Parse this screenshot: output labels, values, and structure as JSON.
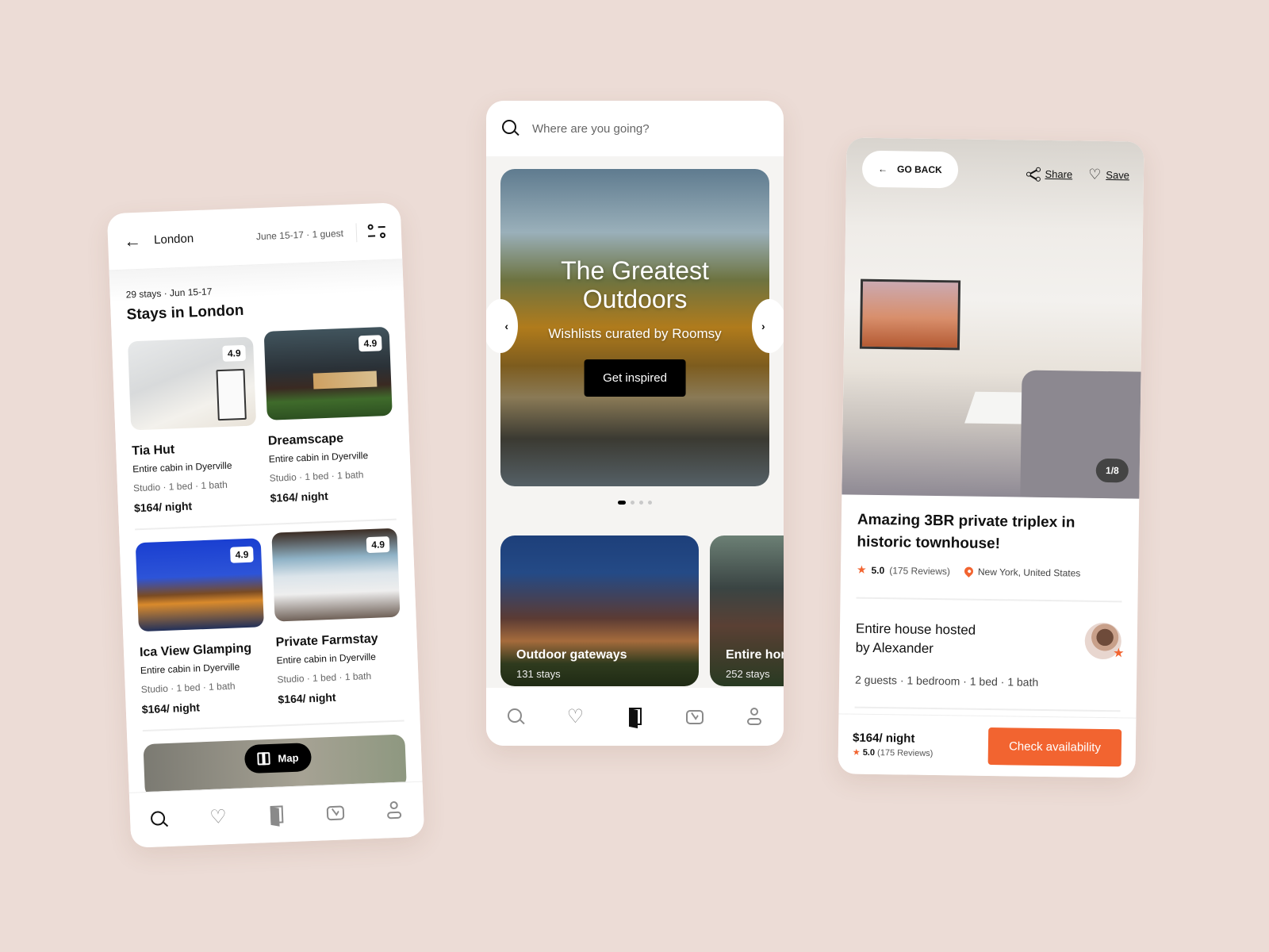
{
  "colors": {
    "background": "#ecdcd6",
    "accent": "#f26430",
    "text": "#111111"
  },
  "results_screen": {
    "header": {
      "back_icon": "arrow-left-icon",
      "city": "London",
      "dates_guests": "June 15-17 · 1 guest",
      "filter_icon": "sliders-icon"
    },
    "summary": "29 stays · Jun 15-17",
    "title": "Stays in London",
    "listings": [
      {
        "name": "Tia Hut",
        "type": "Entire cabin in Dyerville",
        "meta": "Studio · 1 bed · 1 bath",
        "price": "$164/ night",
        "rating": "4.9"
      },
      {
        "name": "Dreamscape",
        "type": "Entire cabin in Dyerville",
        "meta": "Studio · 1 bed · 1 bath",
        "price": "$164/ night",
        "rating": "4.9"
      },
      {
        "name": "Ica View Glamping",
        "type": "Entire cabin in Dyerville",
        "meta": "Studio · 1 bed · 1 bath",
        "price": "$164/ night",
        "rating": "4.9"
      },
      {
        "name": "Private Farmstay",
        "type": "Entire cabin in Dyerville",
        "meta": "Studio · 1 bed · 1 bath",
        "price": "$164/ night",
        "rating": "4.9"
      }
    ],
    "map_button": "Map",
    "tabbar": {
      "active": "search",
      "items": [
        "search",
        "wishlists",
        "trips",
        "inbox",
        "profile"
      ]
    }
  },
  "explore_screen": {
    "search_placeholder": "Where are you going?",
    "hero": {
      "title_line1": "The Greatest",
      "title_line2": "Outdoors",
      "subtitle": "Wishlists curated by Roomsy",
      "cta": "Get inspired"
    },
    "carousel": {
      "current": 1,
      "total": 4
    },
    "collections": [
      {
        "name": "Outdoor gateways",
        "count": "131 stays"
      },
      {
        "name": "Entire homes",
        "count": "252 stays"
      }
    ],
    "tabbar": {
      "active": "trips",
      "items": [
        "search",
        "wishlists",
        "trips",
        "inbox",
        "profile"
      ]
    }
  },
  "detail_screen": {
    "go_back": "GO BACK",
    "share": "Share",
    "save": "Save",
    "photo_counter": "1/8",
    "title": "Amazing 3BR private triplex in historic townhouse!",
    "rating": "5.0",
    "reviews": "(175 Reviews)",
    "location": "New York, United States",
    "host": {
      "line1": "Entire house hosted",
      "line2": "by Alexander"
    },
    "details": "2 guests · 1 bedroom · 1 bed · 1 bath",
    "footer": {
      "price": "$164/ night",
      "rating": "5.0",
      "reviews": "(175 Reviews)",
      "cta": "Check availability"
    }
  }
}
